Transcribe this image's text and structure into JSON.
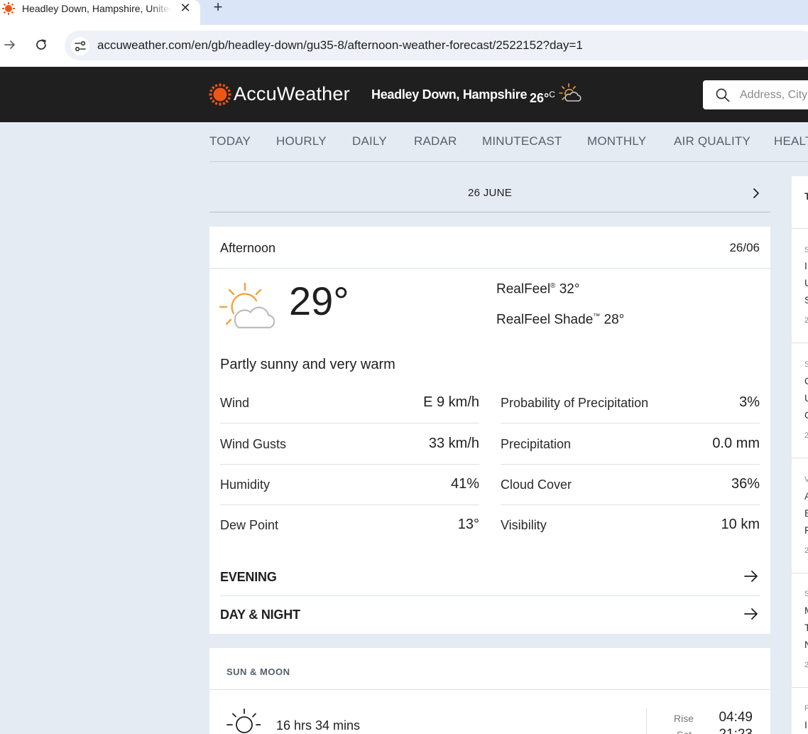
{
  "browser": {
    "tab_title": "Headley Down, Hampshire, United Kingdom Afternoon Weather | AccuWeather",
    "tab_close": "✕",
    "new_tab": "+",
    "url": "accuweather.com/en/gb/headley-down/gu35-8/afternoon-weather-forecast/2522152?day=1"
  },
  "header": {
    "logo": "AccuWeather",
    "location": "Headley Down, Hampshire",
    "current_temp": "26°",
    "current_unit": "C",
    "search_placeholder": "Address, City or Zip Code",
    "brand_color": "#f05514"
  },
  "nav": [
    {
      "label": "TODAY"
    },
    {
      "label": "HOURLY"
    },
    {
      "label": "DAILY"
    },
    {
      "label": "RADAR"
    },
    {
      "label": "MINUTECAST"
    },
    {
      "label": "MONTHLY"
    },
    {
      "label": "AIR QUALITY"
    },
    {
      "label": "HEALTH"
    }
  ],
  "date_header": "26 JUNE",
  "card": {
    "title": "Afternoon",
    "date": "26/06",
    "temperature": "29°",
    "icon": "partly-sunny-icon",
    "realfeel_label": "RealFeel",
    "realfeel_mark": "®",
    "realfeel_value": "32°",
    "realfeel_shade_label": "RealFeel Shade",
    "realfeel_shade_mark": "™",
    "realfeel_shade_value": "28°",
    "phrase": "Partly sunny and very warm",
    "left_details": [
      {
        "label": "Wind",
        "value": "E 9 km/h"
      },
      {
        "label": "Wind Gusts",
        "value": "33 km/h"
      },
      {
        "label": "Humidity",
        "value": "41%"
      },
      {
        "label": "Dew Point",
        "value": "13°"
      }
    ],
    "right_details": [
      {
        "label": "Probability of Precipitation",
        "value": "3%"
      },
      {
        "label": "Precipitation",
        "value": "0.0 mm"
      },
      {
        "label": "Cloud Cover",
        "value": "36%"
      },
      {
        "label": "Visibility",
        "value": "10 km"
      }
    ],
    "links": [
      {
        "label": "EVENING"
      },
      {
        "label": "DAY & NIGHT"
      }
    ]
  },
  "sun_moon": {
    "title": "SUN & MOON",
    "duration": "16 hrs 34 mins",
    "rise_label": "Rise",
    "rise_value": "04:49",
    "set_label": "Set",
    "set_value": "21:23"
  },
  "sidebar_fragments": [
    "T",
    "S",
    "I",
    "U",
    "S",
    "2",
    "S",
    "C",
    "U",
    "C",
    "2",
    "V",
    "A",
    "E",
    "F",
    "2",
    "S",
    "M",
    "T",
    "N",
    "2",
    "F",
    "I"
  ]
}
